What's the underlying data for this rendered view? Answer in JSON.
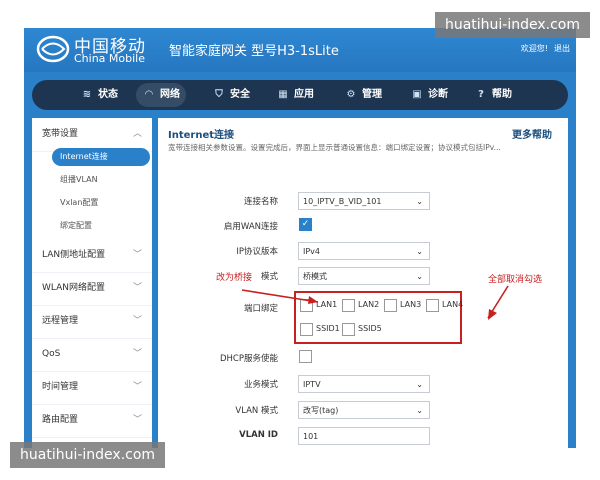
{
  "header": {
    "logo_cn": "中国移动",
    "logo_en": "China Mobile",
    "product_title": "智能家庭网关 型号H3-1sLite",
    "welcome": "欢迎您!",
    "logout": "退出"
  },
  "nav": {
    "items": [
      {
        "label": "状态",
        "icon": "layers-icon"
      },
      {
        "label": "网络",
        "icon": "wifi-icon"
      },
      {
        "label": "安全",
        "icon": "shield-icon"
      },
      {
        "label": "应用",
        "icon": "grid-icon"
      },
      {
        "label": "管理",
        "icon": "gear-icon"
      },
      {
        "label": "诊断",
        "icon": "toolbox-icon"
      },
      {
        "label": "帮助",
        "icon": "question-icon"
      }
    ],
    "active": "网络"
  },
  "sidebar": {
    "groups": [
      {
        "label": "宽带设置",
        "expanded": true
      },
      {
        "label": "LAN侧地址配置"
      },
      {
        "label": "WLAN网络配置"
      },
      {
        "label": "远程管理"
      },
      {
        "label": "QoS"
      },
      {
        "label": "时间管理"
      },
      {
        "label": "路由配置"
      }
    ],
    "subitems": [
      {
        "label": "Internet连接",
        "active": true
      },
      {
        "label": "组播VLAN"
      },
      {
        "label": "Vxlan配置"
      },
      {
        "label": "绑定配置"
      }
    ]
  },
  "content": {
    "title": "Internet连接",
    "help": "更多帮助",
    "description": "宽带连接相关参数设置。设置完成后，界面上显示普通设置信息：端口绑定设置；协议模式包括IPv..."
  },
  "form": {
    "connection_name": {
      "label": "连接名称",
      "value": "10_IPTV_B_VID_101"
    },
    "enable_wan": {
      "label": "启用WAN连接",
      "checked": true
    },
    "ip_version": {
      "label": "IP协议版本",
      "value": "IPv4"
    },
    "mode": {
      "label": "模式",
      "value": "桥模式"
    },
    "port_binding": {
      "label": "端口绑定",
      "ports": [
        {
          "label": "LAN1",
          "checked": false
        },
        {
          "label": "LAN2",
          "checked": false
        },
        {
          "label": "LAN3",
          "checked": false
        },
        {
          "label": "LAN4",
          "checked": false
        },
        {
          "label": "SSID1",
          "checked": false
        },
        {
          "label": "SSID5",
          "checked": false
        }
      ]
    },
    "dhcp": {
      "label": "DHCP服务使能",
      "checked": false
    },
    "service_mode": {
      "label": "业务模式",
      "value": "IPTV"
    },
    "vlan_mode": {
      "label": "VLAN 模式",
      "value": "改写(tag)"
    },
    "vlan_id": {
      "label": "VLAN ID",
      "value": "101"
    }
  },
  "annotations": {
    "bridge_note": "改为桥接",
    "uncheck_note": "全部取消勾选"
  },
  "watermarks": {
    "top": "huatihui-index.com",
    "bottom": "huatihui-index.com"
  },
  "colors": {
    "brand_blue": "#2a80c9",
    "nav_dark": "#1d3550",
    "annotation_red": "#c81f1f"
  }
}
